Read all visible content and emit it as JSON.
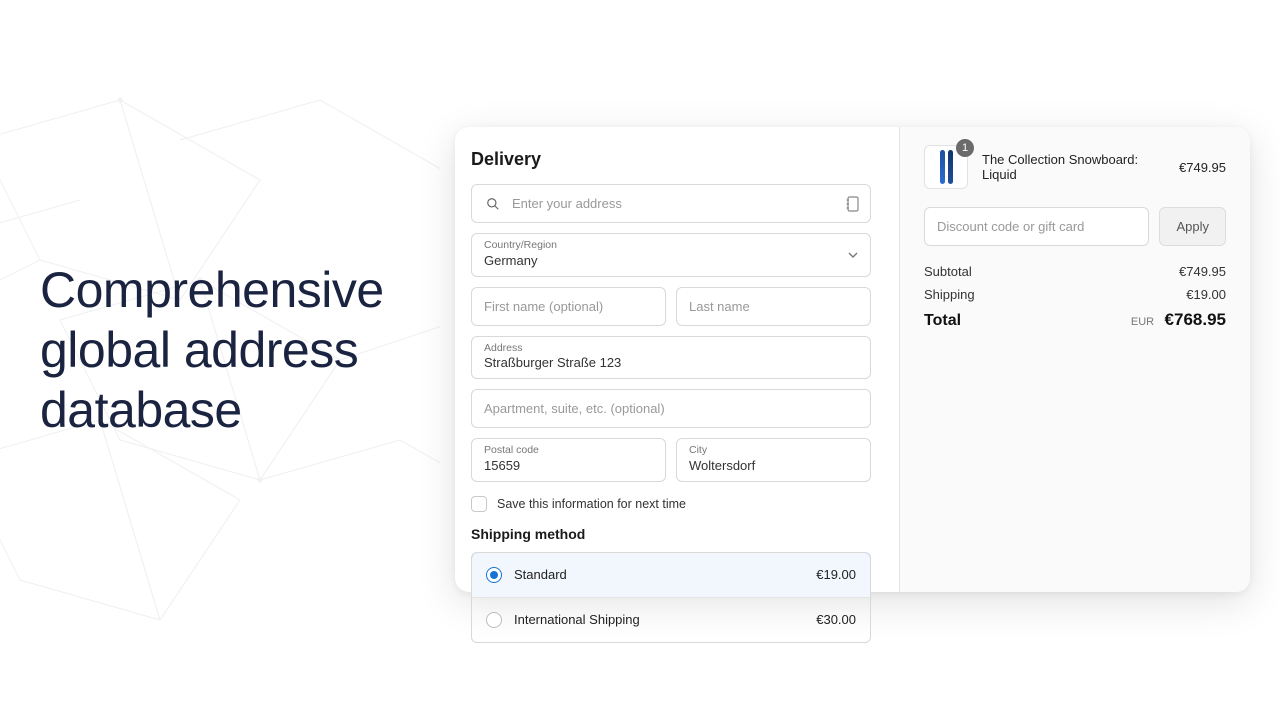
{
  "hero": {
    "headline": "Comprehensive global address database"
  },
  "delivery": {
    "title": "Delivery",
    "search_placeholder": "Enter your address",
    "country_label": "Country/Region",
    "country_value": "Germany",
    "first_name_placeholder": "First name (optional)",
    "last_name_placeholder": "Last name",
    "address_label": "Address",
    "address_value": "Straßburger Straße 123",
    "apt_placeholder": "Apartment, suite, etc. (optional)",
    "postal_label": "Postal code",
    "postal_value": "15659",
    "city_label": "City",
    "city_value": "Woltersdorf",
    "save_label": "Save this information for next time"
  },
  "shipping": {
    "title": "Shipping method",
    "options": [
      {
        "name": "Standard",
        "price": "€19.00",
        "selected": true
      },
      {
        "name": "International Shipping",
        "price": "€30.00",
        "selected": false
      }
    ]
  },
  "cart": {
    "item": {
      "name": "The Collection Snowboard: Liquid",
      "price": "€749.95",
      "qty": "1"
    },
    "discount_placeholder": "Discount code or gift card",
    "apply_label": "Apply",
    "subtotal_label": "Subtotal",
    "subtotal_value": "€749.95",
    "shipping_label": "Shipping",
    "shipping_value": "€19.00",
    "total_label": "Total",
    "currency": "EUR",
    "total_value": "€768.95"
  }
}
